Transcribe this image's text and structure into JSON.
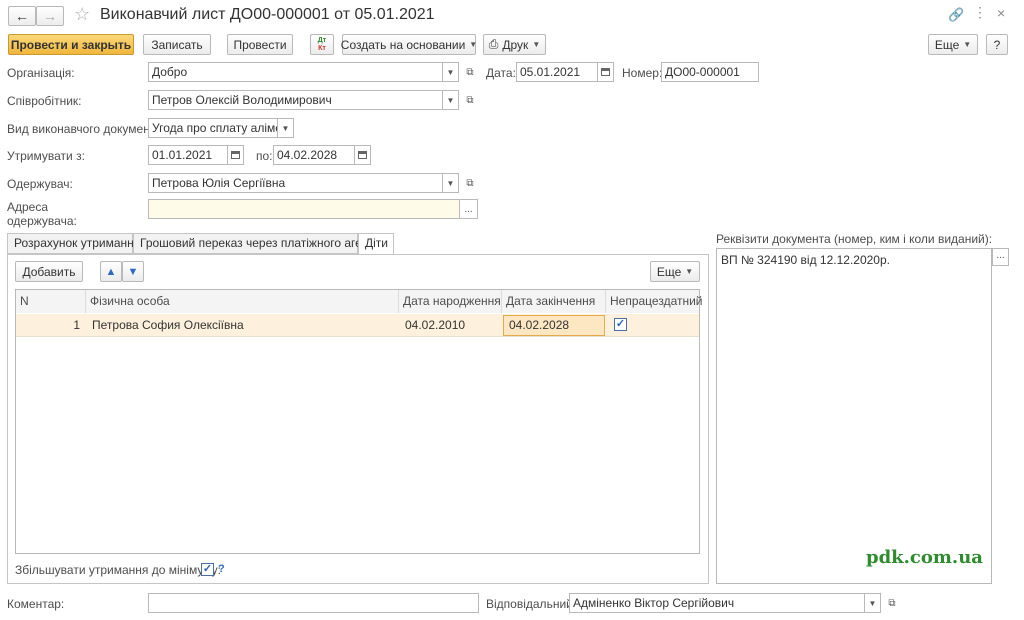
{
  "window": {
    "title": "Виконавчий лист ДО00-000001 от 05.01.2021",
    "link_icon": "link-icon",
    "more_icon": "more-icon",
    "close_icon": "close-icon"
  },
  "toolbar": {
    "post_close": "Провести и закрыть",
    "save": "Записать",
    "post": "Провести",
    "dt_kt_top": "Дт",
    "dt_kt_bottom": "Кт",
    "create_based": "Создать на основании",
    "print": "Друк",
    "more": "Еще",
    "help": "?"
  },
  "form": {
    "org_label": "Організація:",
    "org_value": "Добро",
    "date_label": "Дата:",
    "date_value": "05.01.2021",
    "number_label": "Номер:",
    "number_value": "ДО00-000001",
    "employee_label": "Співробітник:",
    "employee_value": "Петров Олексій Володимирович",
    "doc_kind_label": "Вид виконавчого документа:",
    "doc_kind_value": "Угода про сплату аліменті",
    "withhold_from_label": "Утримувати з:",
    "withhold_from_value": "01.01.2021",
    "to_label": "по:",
    "to_value": "04.02.2028",
    "recipient_label": "Одержувач:",
    "recipient_value": "Петрова Юлія Сергіївна",
    "address_label_1": "Адреса",
    "address_label_2": "одержувача:",
    "address_value": "",
    "address_btn": "..."
  },
  "tabs": [
    {
      "label": "Розрахунок утримання"
    },
    {
      "label": "Грошовий переказ через платіжного агента"
    },
    {
      "label": "Діти"
    }
  ],
  "children": {
    "add_button": "Добавить",
    "more_button": "Еще",
    "columns": [
      "N",
      "Фізична особа",
      "Дата народження",
      "Дата закінчення",
      "Непрацездатний"
    ],
    "rows": [
      {
        "n": "1",
        "person": "Петрова София Олексіївна",
        "birth": "04.02.2010",
        "end": "04.02.2028",
        "disabled": true
      }
    ],
    "increase_label": "Збільшувати утримання до мінімуму:",
    "help_mark": "?"
  },
  "requisites": {
    "label": "Реквізити документа (номер, ким і коли виданий):",
    "value": "ВП № 324190 від 12.12.2020р.",
    "btn": "..."
  },
  "watermark": "pdk.com.ua",
  "bottom": {
    "comment_label": "Коментар:",
    "comment_value": "",
    "responsible_label": "Відповідальний:",
    "responsible_value": "Адміненко Віктор Сергійович"
  },
  "colors": {
    "primary_button": "#f0b63c",
    "selected_row": "#fdf0dc",
    "arrow_blue": "#2f6bc4",
    "watermark": "#2e8b2e"
  }
}
